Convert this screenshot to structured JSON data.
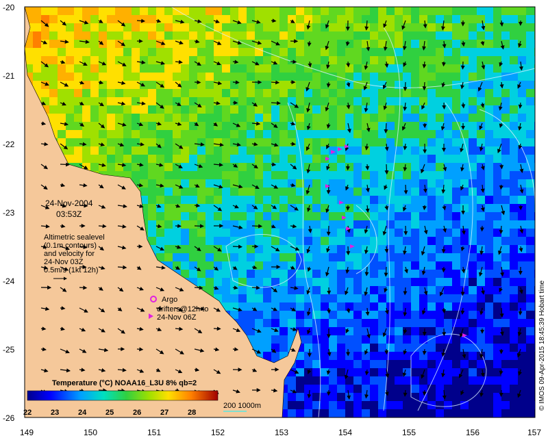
{
  "map": {
    "lat_ticks": [
      "-20",
      "-21",
      "-22",
      "-23",
      "-24",
      "-25",
      "-26"
    ],
    "lon_ticks": [
      "149",
      "150",
      "151",
      "152",
      "153",
      "154",
      "155",
      "156",
      "157"
    ],
    "date": "24-Nov-2004",
    "time": "03:53Z",
    "info_lines": [
      "Altimetric sealevel",
      "(0.1m contours)",
      "and velocity for",
      "24-Nov 03Z",
      "0.5m/s (1kt 12h)"
    ],
    "legend_argo": "Argo",
    "legend_drifters": [
      "drifters@12h to",
      "24-Nov 06Z"
    ],
    "colorbar_title": "Temperature (°C) NOAA16_L3U 8% qb=2",
    "colorbar_ticks": [
      "22",
      "23",
      "24",
      "25",
      "26",
      "27",
      "28"
    ],
    "isobath_label": "200  1000m",
    "credit": "© IMOS 09-Apr-2015 18:45:39 Hobart time",
    "colors": {
      "land": "#f5c89a",
      "argo": "#e020e0",
      "drifter": "#e020e0",
      "contour": "#d8f0ff",
      "isobath": "#7fe0d0"
    }
  }
}
